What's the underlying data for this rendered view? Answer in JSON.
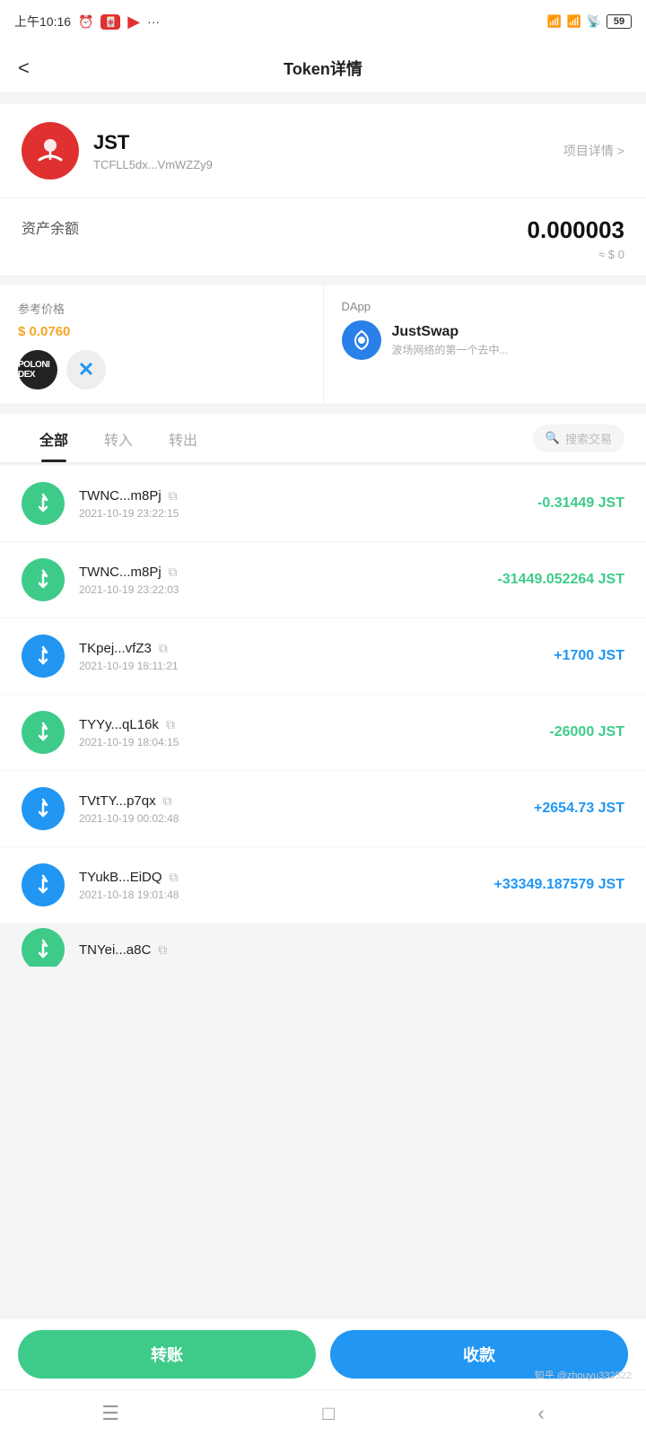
{
  "statusBar": {
    "time": "上午10:16",
    "battery": "59"
  },
  "header": {
    "back": "<",
    "title": "Token详情"
  },
  "token": {
    "name": "JST",
    "address": "TCFLL5dx...VmWZZy9",
    "detailLink": "项目详情 >"
  },
  "balance": {
    "label": "资产余额",
    "amount": "0.000003",
    "usd": "≈ $ 0"
  },
  "price": {
    "label": "参考价格",
    "value": "$ 0.0760"
  },
  "dapp": {
    "label": "DApp",
    "name": "JustSwap",
    "desc": "波场网络的第一个去中..."
  },
  "tabs": {
    "all": "全部",
    "in": "转入",
    "out": "转出",
    "searchPlaceholder": "搜索交易"
  },
  "transactions": [
    {
      "address": "TWNC...m8Pj",
      "time": "2021-10-19 23:22:15",
      "amount": "-0.31449 JST",
      "type": "negative",
      "iconType": "green"
    },
    {
      "address": "TWNC...m8Pj",
      "time": "2021-10-19 23:22:03",
      "amount": "-31449.052264 JST",
      "type": "negative",
      "iconType": "green"
    },
    {
      "address": "TKpej...vfZ3",
      "time": "2021-10-19 18:11:21",
      "amount": "+1700 JST",
      "type": "positive",
      "iconType": "blue"
    },
    {
      "address": "TYYy...qL16k",
      "time": "2021-10-19 18:04:15",
      "amount": "-26000 JST",
      "type": "negative",
      "iconType": "green"
    },
    {
      "address": "TVtTY...p7qx",
      "time": "2021-10-19 00:02:48",
      "amount": "+2654.73 JST",
      "type": "positive",
      "iconType": "blue"
    },
    {
      "address": "TYukB...EiDQ",
      "time": "2021-10-18 19:01:48",
      "amount": "+33349.187579 JST",
      "type": "positive",
      "iconType": "blue"
    }
  ],
  "partialTx": {
    "address": "TNYei...a8C",
    "iconType": "green"
  },
  "buttons": {
    "transfer": "转账",
    "receive": "收款"
  },
  "watermark": "知乎 @zhouyu332522"
}
